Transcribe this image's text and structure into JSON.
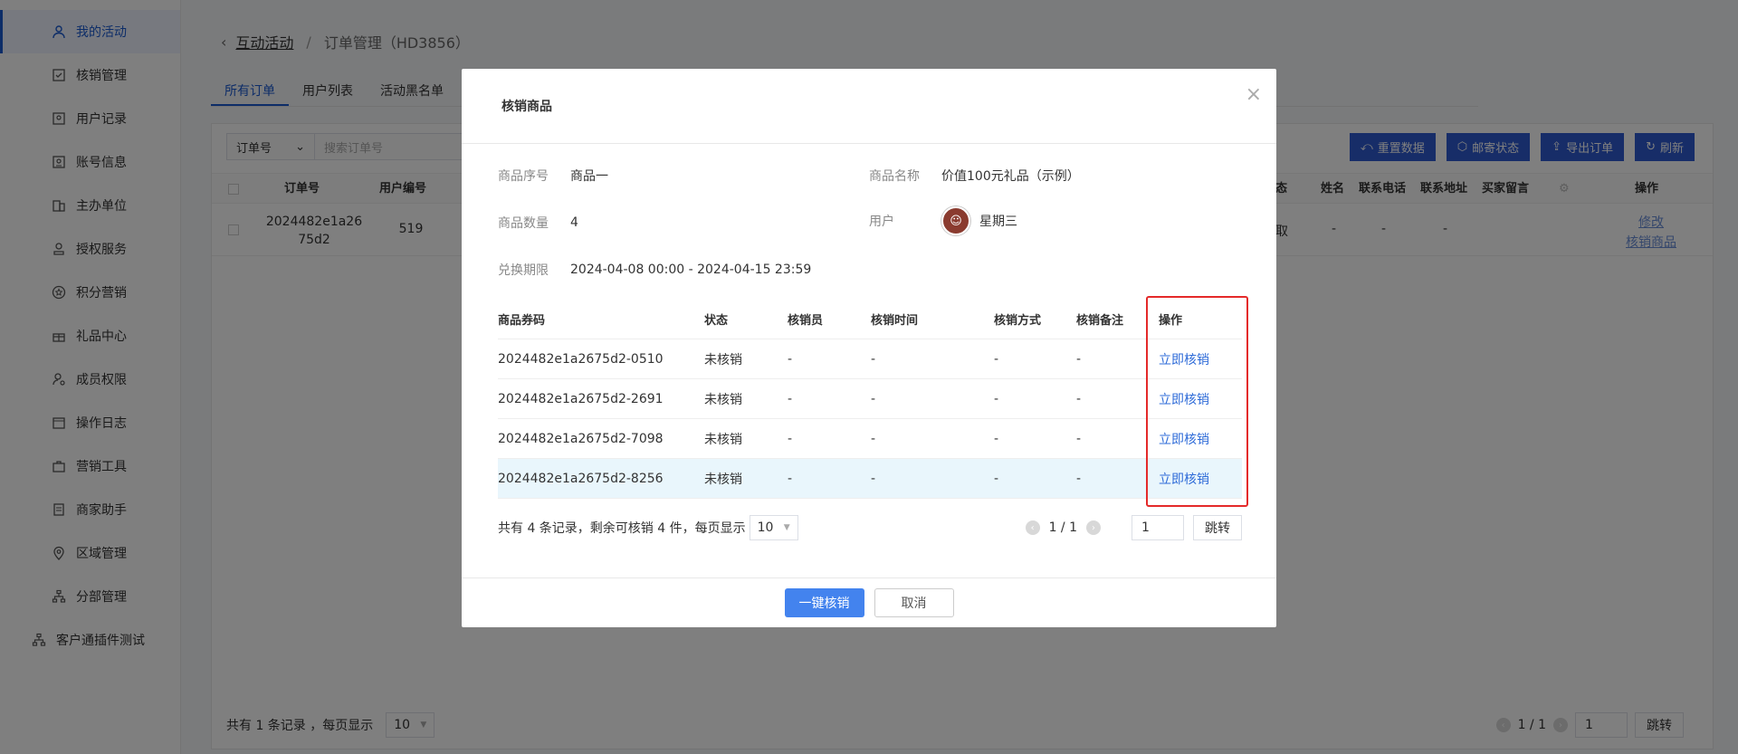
{
  "sidebar": {
    "items": [
      {
        "label": "我的活动",
        "icon": "user-icon",
        "active": true
      },
      {
        "label": "核销管理",
        "icon": "check-icon"
      },
      {
        "label": "用户记录",
        "icon": "contact-icon"
      },
      {
        "label": "账号信息",
        "icon": "id-card-icon"
      },
      {
        "label": "主办单位",
        "icon": "building-icon"
      },
      {
        "label": "授权服务",
        "icon": "stamp-icon"
      },
      {
        "label": "积分营销",
        "icon": "star-icon"
      },
      {
        "label": "礼品中心",
        "icon": "gift-icon"
      },
      {
        "label": "成员权限",
        "icon": "member-key-icon"
      },
      {
        "label": "操作日志",
        "icon": "calendar-log-icon"
      },
      {
        "label": "营销工具",
        "icon": "toolbox-icon"
      },
      {
        "label": "商家助手",
        "icon": "document-icon"
      },
      {
        "label": "区域管理",
        "icon": "location-icon"
      },
      {
        "label": "分部管理",
        "icon": "org-chart-icon"
      },
      {
        "label": "客户通插件测试",
        "icon": "org-chart-icon"
      }
    ]
  },
  "breadcrumb": {
    "parent": "互动活动",
    "separator": "/",
    "current": "订单管理（HD3856）"
  },
  "tabs": [
    "所有订单",
    "用户列表",
    "活动黑名单"
  ],
  "filter": {
    "select_value": "订单号",
    "search_placeholder": "搜索订单号"
  },
  "actions": [
    "重置数据",
    "邮寄状态",
    "导出订单",
    "刷新"
  ],
  "table": {
    "headers": {
      "order_no": "订单号",
      "user_no": "用户编号",
      "status": "态",
      "name": "姓名",
      "phone": "联系电话",
      "address": "联系地址",
      "message": "买家留言",
      "ops": "操作"
    },
    "row": {
      "order_no_1": "2024482e1a26",
      "order_no_2": "75d2",
      "user_no": "519",
      "status": "取",
      "name": "-",
      "phone": "-",
      "address": "-",
      "op1": "修改",
      "op2": "核销商品"
    }
  },
  "footer": {
    "summary": "共有 1 条记录 ，每页显示",
    "page_size": "10",
    "page": "1 / 1",
    "page_input": "1",
    "jump": "跳转"
  },
  "modal": {
    "title": "核销商品",
    "close": "×",
    "fields": {
      "seq_label": "商品序号",
      "seq_value": "商品一",
      "name_label": "商品名称",
      "name_value": "价值100元礼品（示例）",
      "qty_label": "商品数量",
      "qty_value": "4",
      "user_label": "用户",
      "user_value": "星期三",
      "period_label": "兑换期限",
      "period_value": "2024-04-08 00:00 - 2024-04-15 23:59"
    },
    "table": {
      "headers": [
        "商品券码",
        "状态",
        "核销员",
        "核销时间",
        "核销方式",
        "核销备注",
        "操作"
      ],
      "rows": [
        [
          "2024482e1a2675d2-0510",
          "未核销",
          "-",
          "-",
          "-",
          "-",
          "立即核销"
        ],
        [
          "2024482e1a2675d2-2691",
          "未核销",
          "-",
          "-",
          "-",
          "-",
          "立即核销"
        ],
        [
          "2024482e1a2675d2-7098",
          "未核销",
          "-",
          "-",
          "-",
          "-",
          "立即核销"
        ],
        [
          "2024482e1a2675d2-8256",
          "未核销",
          "-",
          "-",
          "-",
          "-",
          "立即核销"
        ]
      ]
    },
    "footer": {
      "summary": "共有 4 条记录，剩余可核销 4 件，每页显示",
      "page_size": "10",
      "page": "1 / 1",
      "page_input": "1",
      "jump": "跳转"
    },
    "buttons": {
      "ok": "一键核销",
      "cancel": "取消"
    }
  },
  "colors": {
    "primary": "#2e5bd1",
    "link": "#2e6bd8",
    "highlight_box": "#e42a2a",
    "ok_button": "#4383ee"
  }
}
